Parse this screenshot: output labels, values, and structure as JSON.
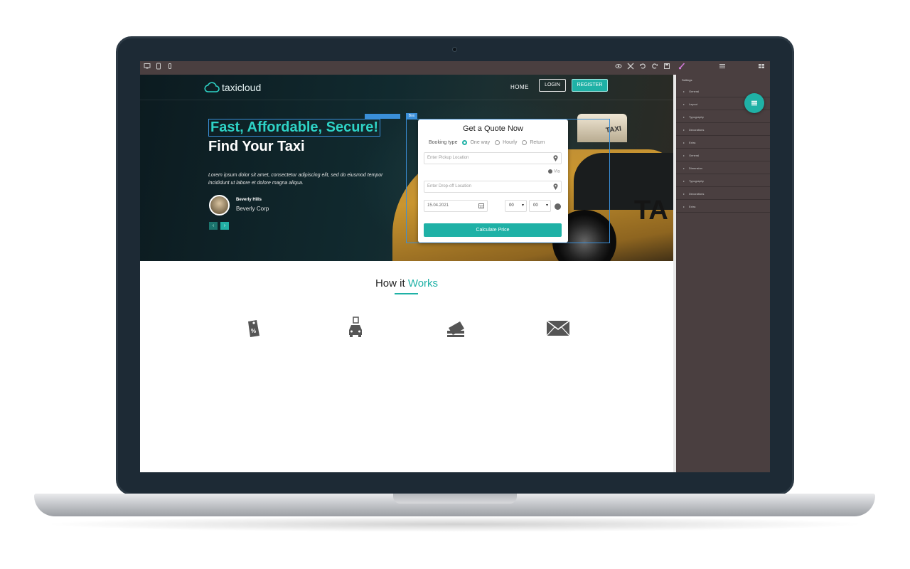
{
  "editor": {
    "icons_left": [
      "desktop-icon",
      "tablet-icon",
      "mobile-icon"
    ],
    "icons_right": [
      "eye-icon",
      "fullscreen-icon",
      "undo-icon",
      "redo-icon",
      "save-icon",
      "brush-icon",
      "menu-icon",
      "grid-icon"
    ]
  },
  "site": {
    "brand": "taxicloud",
    "nav": {
      "home": "HOME",
      "login": "LOGIN",
      "register": "REGISTER"
    }
  },
  "hero": {
    "headline1": "Fast, Affordable, Secure!",
    "headline2": "Find Your Taxi",
    "lorem": "Lorem ipsum dolor sit amet, consectetur adipiscing elit, sed do eiusmod tempor incididunt ut labore et dolore magna aliqua.",
    "person_name": "Beverly Hills",
    "person_company": "Beverly Corp",
    "prev": "‹",
    "next": "›",
    "taxi_sign": "TAXI",
    "taxi_letters": "TA"
  },
  "quote": {
    "box_tag": "Box",
    "title": "Get a Quote Now",
    "booking_label": "Booking type",
    "options": [
      "One way",
      "Hourly",
      "Return"
    ],
    "selected_option": "One way",
    "pickup_placeholder": "Enter Pickup Location",
    "via": "Via",
    "dropoff_placeholder": "Enter Drop-off Location",
    "date": "15.04.2021",
    "hour": "00",
    "minute": "00",
    "calculate": "Calculate Price"
  },
  "how": {
    "title_main": "How it",
    "title_accent": "Works",
    "features": [
      "discount-tag-icon",
      "car-booking-icon",
      "payment-card-icon",
      "envelope-icon"
    ]
  },
  "panel": {
    "title": "Settings",
    "items": [
      "General",
      "Layout",
      "Typography",
      "Decorations",
      "Extra",
      "General",
      "Dimension",
      "Typography",
      "Decorations",
      "Extra"
    ]
  },
  "colors": {
    "accent": "#1fb1a6",
    "editor_bg": "#4a3f40",
    "selection": "#3a8fd9"
  }
}
